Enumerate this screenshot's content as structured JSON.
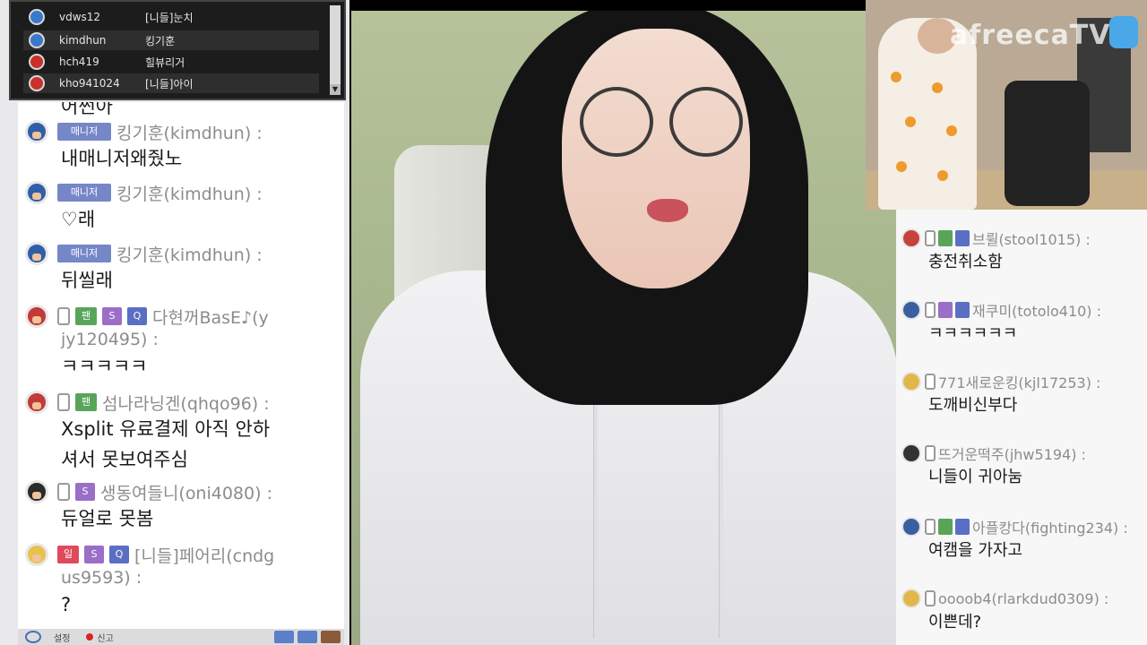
{
  "viewer_list": [
    {
      "id": "vdws12",
      "nick": "[니들]눈치"
    },
    {
      "id": "kimdhun",
      "nick": "킹기훈"
    },
    {
      "id": "hch419",
      "nick": "힐뷰리거"
    },
    {
      "id": "kho941024",
      "nick": "[니들]아이"
    }
  ],
  "viewer_scroll_arrow": "▼",
  "left_chat": {
    "partial_top": "어쩐아",
    "messages": [
      {
        "badge": "매니저",
        "nick": "킹기훈(kimdhun) :",
        "text": [
          "내매니저왜줬노"
        ]
      },
      {
        "badge": "매니저",
        "nick": "킹기훈(kimdhun) :",
        "text": [
          "♡래"
        ]
      },
      {
        "badge": "매니저",
        "nick": "킹기훈(kimdhun) :",
        "text": [
          "뒤씰래"
        ]
      },
      {
        "fan": "팬",
        "sub": "S",
        "q": "Q",
        "nick": "다현꺼BasE♪(y",
        "nick2": "jy120495) :",
        "text": [
          "ㅋㅋㅋㅋㅋ"
        ]
      },
      {
        "fan": "팬",
        "nick": "섬나라닝겐(qhqo96) :",
        "text": [
          "Xsplit 유료결제 아직 안하",
          "셔서 못보여주심"
        ]
      },
      {
        "sub": "S",
        "nick": "생동여들니(oni4080) :",
        "text": [
          "듀얼로 못봄"
        ]
      },
      {
        "red": "일",
        "sub": "S",
        "q": "Q",
        "nick": "[니들]페어리(cndg",
        "nick2": "us9593) :",
        "text": [
          "?"
        ]
      }
    ]
  },
  "chat_bottom": {
    "settings_label": "설정",
    "report_label": "신고"
  },
  "cam_overlay": {
    "logo_text": "afreecaTV"
  },
  "right_chat": [
    {
      "nick": "브륄(stool1015) :",
      "text": "충전취소함"
    },
    {
      "nick": "재쿠미(totolo410) :",
      "text": "ㅋㅋㅋㅋㅋㅋ"
    },
    {
      "nick": "771새로운킹(kjl17253) :",
      "text": "도깨비신부다"
    },
    {
      "nick": "뜨거운떡주(jhw5194) :",
      "text": "니들이 귀아눔"
    },
    {
      "nick": "아플캉다(fighting234) :",
      "text": "여캠을 가자고"
    },
    {
      "nick": "oooob4(rlarkdud0309) :",
      "text": "이쁜데?"
    }
  ]
}
